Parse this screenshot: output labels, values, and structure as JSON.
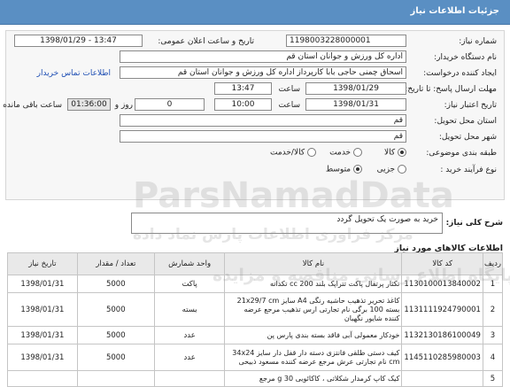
{
  "header": {
    "title": "جزئیات اطلاعات نیاز"
  },
  "form": {
    "need_number_label": "شماره نیاز:",
    "need_number": "1198003228000001",
    "announce_label": "تاریخ و ساعت اعلان عمومی:",
    "announce_value": "1398/01/29 - 13:47",
    "buyer_org_label": "نام دستگاه خریدار:",
    "buyer_org": "اداره کل ورزش و جوانان استان قم",
    "creator_label": "ایجاد کننده درخواست:",
    "creator": "اسحاق چمنی حاجی بابا کارپرداز اداره کل ورزش و جوانان استان قم",
    "contact_link": "اطلاعات تماس خریدار",
    "send_deadline_label": "مهلت ارسال پاسخ: تا تاریخ:",
    "send_deadline_date": "1398/01/29",
    "time_label": "ساعت",
    "send_deadline_time": "13:47",
    "validity_label": "تاریخ اعتبار نیاز:",
    "validity_date": "1398/01/31",
    "validity_time": "10:00",
    "days_value": "0",
    "days_label": "روز و",
    "remaining_time": "01:36:00",
    "remaining_label": "ساعت باقی مانده",
    "delivery_province_label": "استان محل تحویل:",
    "delivery_province": "قم",
    "delivery_city_label": "شهر محل تحویل:",
    "delivery_city": "قم",
    "category_label": "طبقه بندی موضوعی:",
    "category_options": [
      "کالا",
      "خدمت",
      "کالا/خدمت"
    ],
    "category_selected": 0,
    "process_label": "نوع فرآیند خرید :",
    "process_options": [
      "جزیی",
      "متوسط"
    ],
    "process_selected": 1,
    "description_label": "شرح کلی نیاز:",
    "description": "خرید به صورت یک تحویل گردد"
  },
  "items_section": {
    "title": "اطلاعات کالاهای مورد نیاز",
    "columns": [
      "ردیف",
      "کد کالا",
      "نام کالا",
      "واحد شمارش",
      "تعداد / مقدار",
      "تاریخ نیاز"
    ],
    "rows": [
      {
        "row": "1",
        "code": "1130100013840002",
        "name": "تکثار پرتقال پاکت تتراپک بلند 200 cc تکدانه",
        "unit": "پاکت",
        "qty": "5000",
        "date": "1398/01/31"
      },
      {
        "row": "2",
        "code": "1131111924790001",
        "name": "کاغذ تحریر تذهیب حاشیه رنگی A4 سایز 21x29/7 cm بسته 100 برگی نام تجارتی ارس تذهیب مرجع عرضه کننده شایور نگهبان",
        "unit": "بسته",
        "qty": "5000",
        "date": "1398/01/31"
      },
      {
        "row": "3",
        "code": "1132130186100049",
        "name": "خودکار معمولی آبی فاقد بسته بندی پارس پن",
        "unit": "عدد",
        "qty": "5000",
        "date": "1398/01/31"
      },
      {
        "row": "4",
        "code": "1145110285980003",
        "name": "کیف دستی طلقی فانتزی دسته دار قفل دار سایز 34x24 cm نام تجارتی عرش مرجع عرضه کننده مسعود ذبیحی",
        "unit": "عدد",
        "qty": "5000",
        "date": "1398/01/31"
      },
      {
        "row": "5",
        "code": "",
        "name": "کیک کاپ کرمدار شکلاتی ، کاکائویی 30 g مرجع",
        "unit": "",
        "qty": "",
        "date": ""
      }
    ]
  },
  "watermark": {
    "text_latin": "ParsNamadData",
    "text_fa": "مرکز فراوری اطلاعات پارس نماد داده",
    "text_fa2": "پایگاه اطلاع رسانی مناقصه و مزایده"
  }
}
